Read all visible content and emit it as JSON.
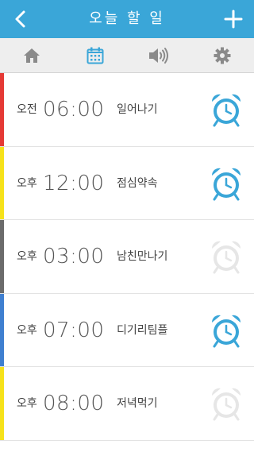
{
  "header": {
    "title": "오늘 할 일",
    "background": "#3aa6d8"
  },
  "tabs": [
    {
      "name": "home",
      "icon": "home-icon",
      "active": false
    },
    {
      "name": "calendar",
      "icon": "calendar-icon",
      "active": true
    },
    {
      "name": "sound",
      "icon": "speaker-icon",
      "active": false
    },
    {
      "name": "settings",
      "icon": "gear-icon",
      "active": false
    }
  ],
  "colors": {
    "accent": "#3aa6d8",
    "alarm_on": "#3aa6d8",
    "alarm_off": "#e6e6e6",
    "tab_inactive": "#8a8a8a"
  },
  "items": [
    {
      "ampm": "오전",
      "time": "06:00",
      "task": "일어나기",
      "color": "#e53935",
      "alarm": "on"
    },
    {
      "ampm": "오후",
      "time": "12:00",
      "task": "점심약속",
      "color": "#f6e21b",
      "alarm": "on"
    },
    {
      "ampm": "오후",
      "time": "03:00",
      "task": "남친만나기",
      "color": "#6b6b6b",
      "alarm": "off"
    },
    {
      "ampm": "오후",
      "time": "07:00",
      "task": "디기리팀플",
      "color": "#3f7fd0",
      "alarm": "on"
    },
    {
      "ampm": "오후",
      "time": "08:00",
      "task": "저녁먹기",
      "color": "#f6e21b",
      "alarm": "off"
    }
  ]
}
